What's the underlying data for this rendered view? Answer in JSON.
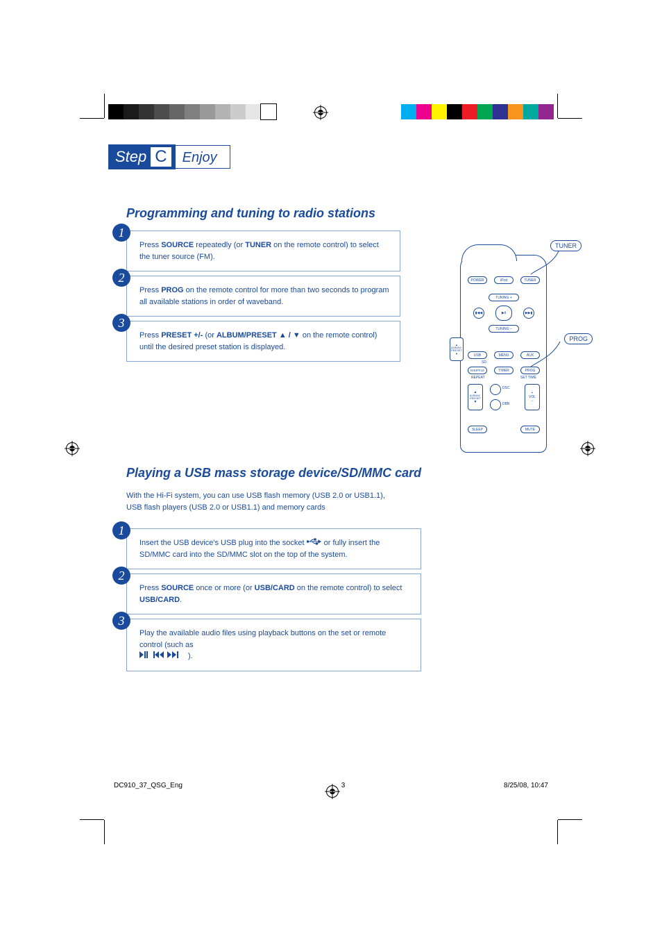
{
  "step": {
    "label": "Step",
    "letter": "C",
    "sub": "Enjoy"
  },
  "section1": {
    "title": "Programming and tuning to radio stations",
    "steps": [
      {
        "n": "1",
        "pre": "Press ",
        "k1": "SOURCE",
        "mid": " repeatedly (or ",
        "k2": "TUNER",
        "post": " on the remote control) to select the tuner source (FM)."
      },
      {
        "n": "2",
        "pre": "Press ",
        "k1": "PROG",
        "post": " on the remote control for more than two seconds to program all available stations in order of waveband."
      },
      {
        "n": "3",
        "pre": "Press ",
        "k1": "PRESET +/-",
        "mid": " (or ",
        "k2": "ALBUM/PRESET ",
        "arrows": "▲ / ▼",
        "post": " on the remote control)  until the desired preset station is displayed."
      }
    ]
  },
  "section2": {
    "title": "Playing a USB mass storage device/SD/MMC card",
    "sub1": "With the Hi-Fi system, you can use USB flash memory (USB 2.0 or USB1.1),",
    "sub2": "USB flash players (USB 2.0 or USB1.1) and memory cards",
    "steps": [
      {
        "n": "1",
        "pre": "Insert the USB device's USB plug into the socket ",
        "post": " or fully insert the SD/MMC card into the SD/MMC slot on the top of the system."
      },
      {
        "n": "2",
        "pre": "Press ",
        "k1": "SOURCE",
        "mid": " once or more (or ",
        "k2": "USB/CARD",
        "mid2": " on the remote control) to select ",
        "k3": "USB/CARD",
        "post": "."
      },
      {
        "n": "3",
        "pre": "Play the available audio files using playback buttons on the set or remote control (such as ",
        "icons": "▶Ⅱ   ◀◀ ▶▶",
        "post": ")."
      }
    ]
  },
  "remote": {
    "callout1": "TUNER",
    "callout2": "PROG",
    "labels": {
      "power": "POWER",
      "ipod": "iPod",
      "tuner": "TUNER",
      "tuningp": "TUNING +",
      "tuningm": "TUNING –",
      "prev": "▮◀◀",
      "play": "▶Ⅱ",
      "next": "▶▶▮",
      "usb": "USB",
      "menu": "MENU",
      "aux": "AUX",
      "sd": "SD",
      "shuffle": "SHUFFLE",
      "timer": "TIMER",
      "prog": "PROG",
      "repeat": "REPEAT",
      "settime": "SET TIME",
      "albumup": "▲",
      "albumlbl": "ALBUM/\nPRESET",
      "albumdn": "▼",
      "dsc": "DSC",
      "dbb": "DBB",
      "volp": "+",
      "vol": "VOL",
      "volm": "–",
      "sleep": "SLEEP",
      "mute": "MUTE",
      "alb2up": "▲",
      "alb2": "ALBUM/\nPRESET",
      "alb2dn": "▼"
    }
  },
  "footer": {
    "file": "DC910_37_QSG_Eng",
    "page": "3",
    "date": "8/25/08, 10:47"
  },
  "colorbars": {
    "grays": [
      "#000000",
      "#1a1a1a",
      "#333333",
      "#4d4d4d",
      "#666666",
      "#808080",
      "#999999",
      "#b3b3b3",
      "#cccccc",
      "#e6e6e6",
      "#ffffff"
    ],
    "colors": [
      "#00aeef",
      "#ec008c",
      "#fff200",
      "#000000",
      "#ed1c24",
      "#00a651",
      "#2e3192",
      "#f7941d",
      "#00a99d",
      "#92278f"
    ]
  }
}
